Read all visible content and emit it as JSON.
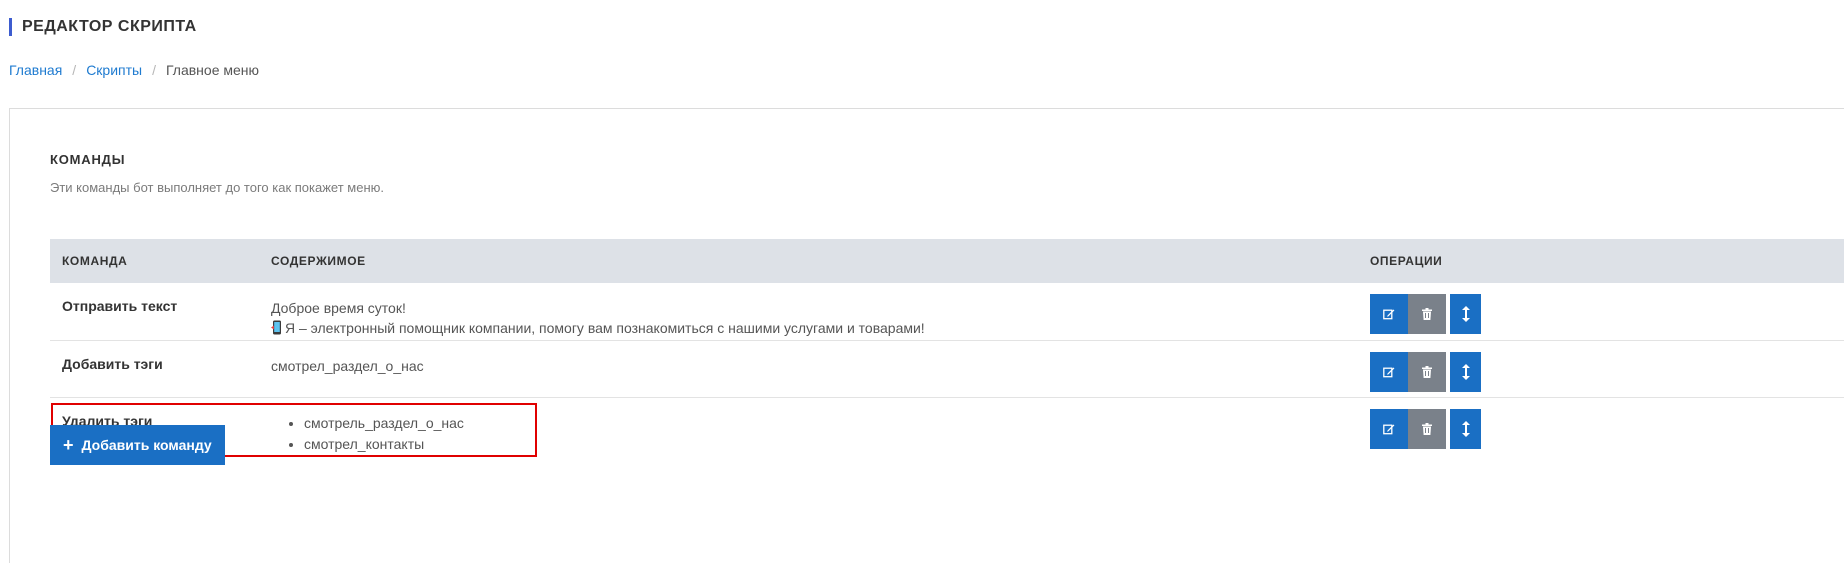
{
  "header": {
    "title": "РЕДАКТОР СКРИПТА"
  },
  "breadcrumb": {
    "items": [
      "Главная",
      "Скрипты"
    ],
    "separator": "/",
    "current": "Главное меню"
  },
  "section": {
    "title": "КОМАНДЫ",
    "description": "Эти команды бот выполняет до того как покажет меню."
  },
  "table": {
    "columns": [
      "КОМАНДА",
      "СОДЕРЖИМОЕ",
      "ОПЕРАЦИИ"
    ],
    "rows": [
      {
        "command": "Отправить текст",
        "content_lines": [
          "Доброе время суток!",
          "Я – электронный помощник компании, помогу вам познакомиться с нашими услугами и товарами!"
        ]
      },
      {
        "command": "Добавить тэги",
        "content_lines": [
          "смотрел_раздел_о_нас"
        ]
      },
      {
        "command": "Удалить тэги",
        "content_list": [
          "смотрель_раздел_о_нас",
          "смотрел_контакты"
        ]
      }
    ],
    "operations": [
      "edit-icon",
      "trash-icon",
      "move-vertical-icon"
    ]
  },
  "add_button": {
    "label": "Добавить команду"
  },
  "colors": {
    "accent": "#1a6fc4",
    "header_bar": "#3d5ccf",
    "delete_button": "#7a818a",
    "table_header": "#dde1e7",
    "highlight": "#e00000",
    "link": "#1f7bd0"
  }
}
